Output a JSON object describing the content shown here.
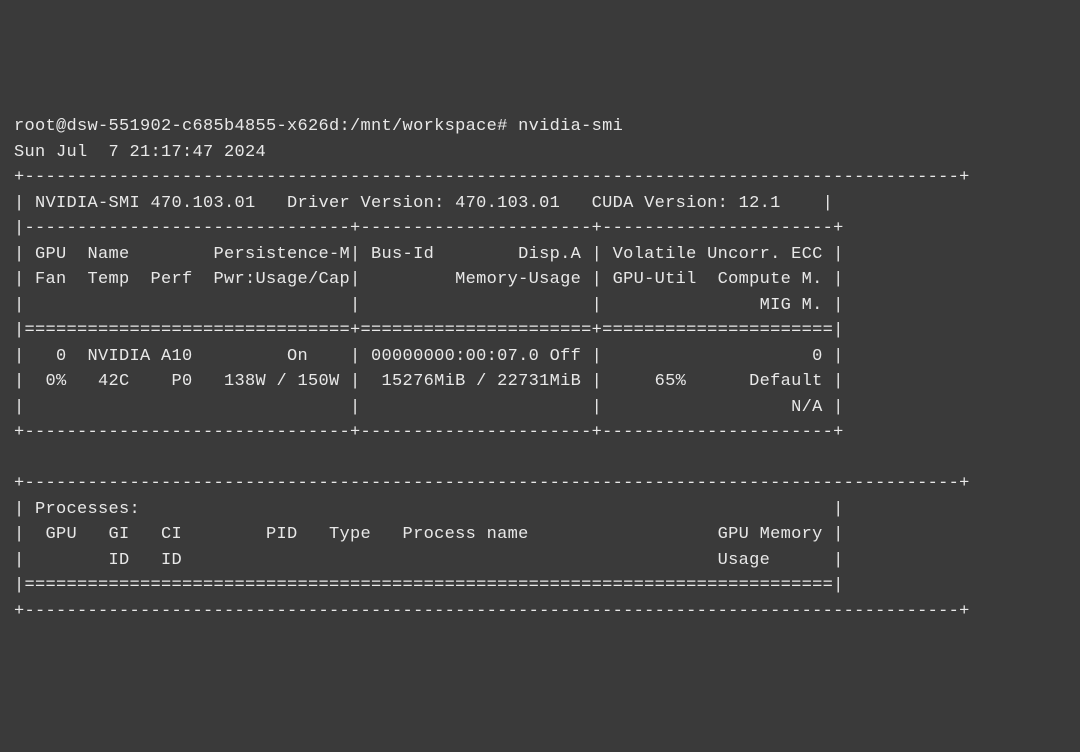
{
  "prompt": "root@dsw-551902-c685b4855-x626d:/mnt/workspace# nvidia-smi",
  "datetime": "Sun Jul  7 21:17:47 2024",
  "border_top": "+-----------------------------------------------------------------------------------------+",
  "header_line": "| NVIDIA-SMI 470.103.01   Driver Version: 470.103.01   CUDA Version: 12.1    |",
  "header_sep": "|-------------------------------+----------------------+----------------------+",
  "col_header1": "| GPU  Name        Persistence-M| Bus-Id        Disp.A | Volatile Uncorr. ECC |",
  "col_header2": "| Fan  Temp  Perf  Pwr:Usage/Cap|         Memory-Usage | GPU-Util  Compute M. |",
  "col_header3": "|                               |                      |               MIG M. |",
  "table_sep": "|===============================+======================+======================|",
  "gpu_row1": "|   0  NVIDIA A10         On    | 00000000:00:07.0 Off |                    0 |",
  "gpu_row2": "|  0%   42C    P0   138W / 150W |  15276MiB / 22731MiB |     65%      Default |",
  "gpu_row3": "|                               |                      |                  N/A |",
  "border_mid": "+-------------------------------+----------------------+----------------------+",
  "blank_border": "                                                                                           ",
  "proc_top": "+-----------------------------------------------------------------------------------------+",
  "proc_header": "| Processes:                                                                  |",
  "proc_cols1": "|  GPU   GI   CI        PID   Type   Process name                  GPU Memory |",
  "proc_cols2": "|        ID   ID                                                   Usage      |",
  "proc_sep": "|=============================================================================|",
  "proc_bottom": "+-----------------------------------------------------------------------------------------+",
  "chart_data": {
    "type": "table",
    "nvidia_smi_version": "470.103.01",
    "driver_version": "470.103.01",
    "cuda_version": "12.1",
    "gpus": [
      {
        "index": 0,
        "name": "NVIDIA A10",
        "persistence_mode": "On",
        "bus_id": "00000000:00:07.0",
        "display_active": "Off",
        "ecc": "0",
        "fan": "0%",
        "temp": "42C",
        "perf": "P0",
        "power_usage": "138W",
        "power_cap": "150W",
        "memory_used": "15276MiB",
        "memory_total": "22731MiB",
        "gpu_util": "65%",
        "compute_mode": "Default",
        "mig_mode": "N/A"
      }
    ],
    "processes": []
  }
}
